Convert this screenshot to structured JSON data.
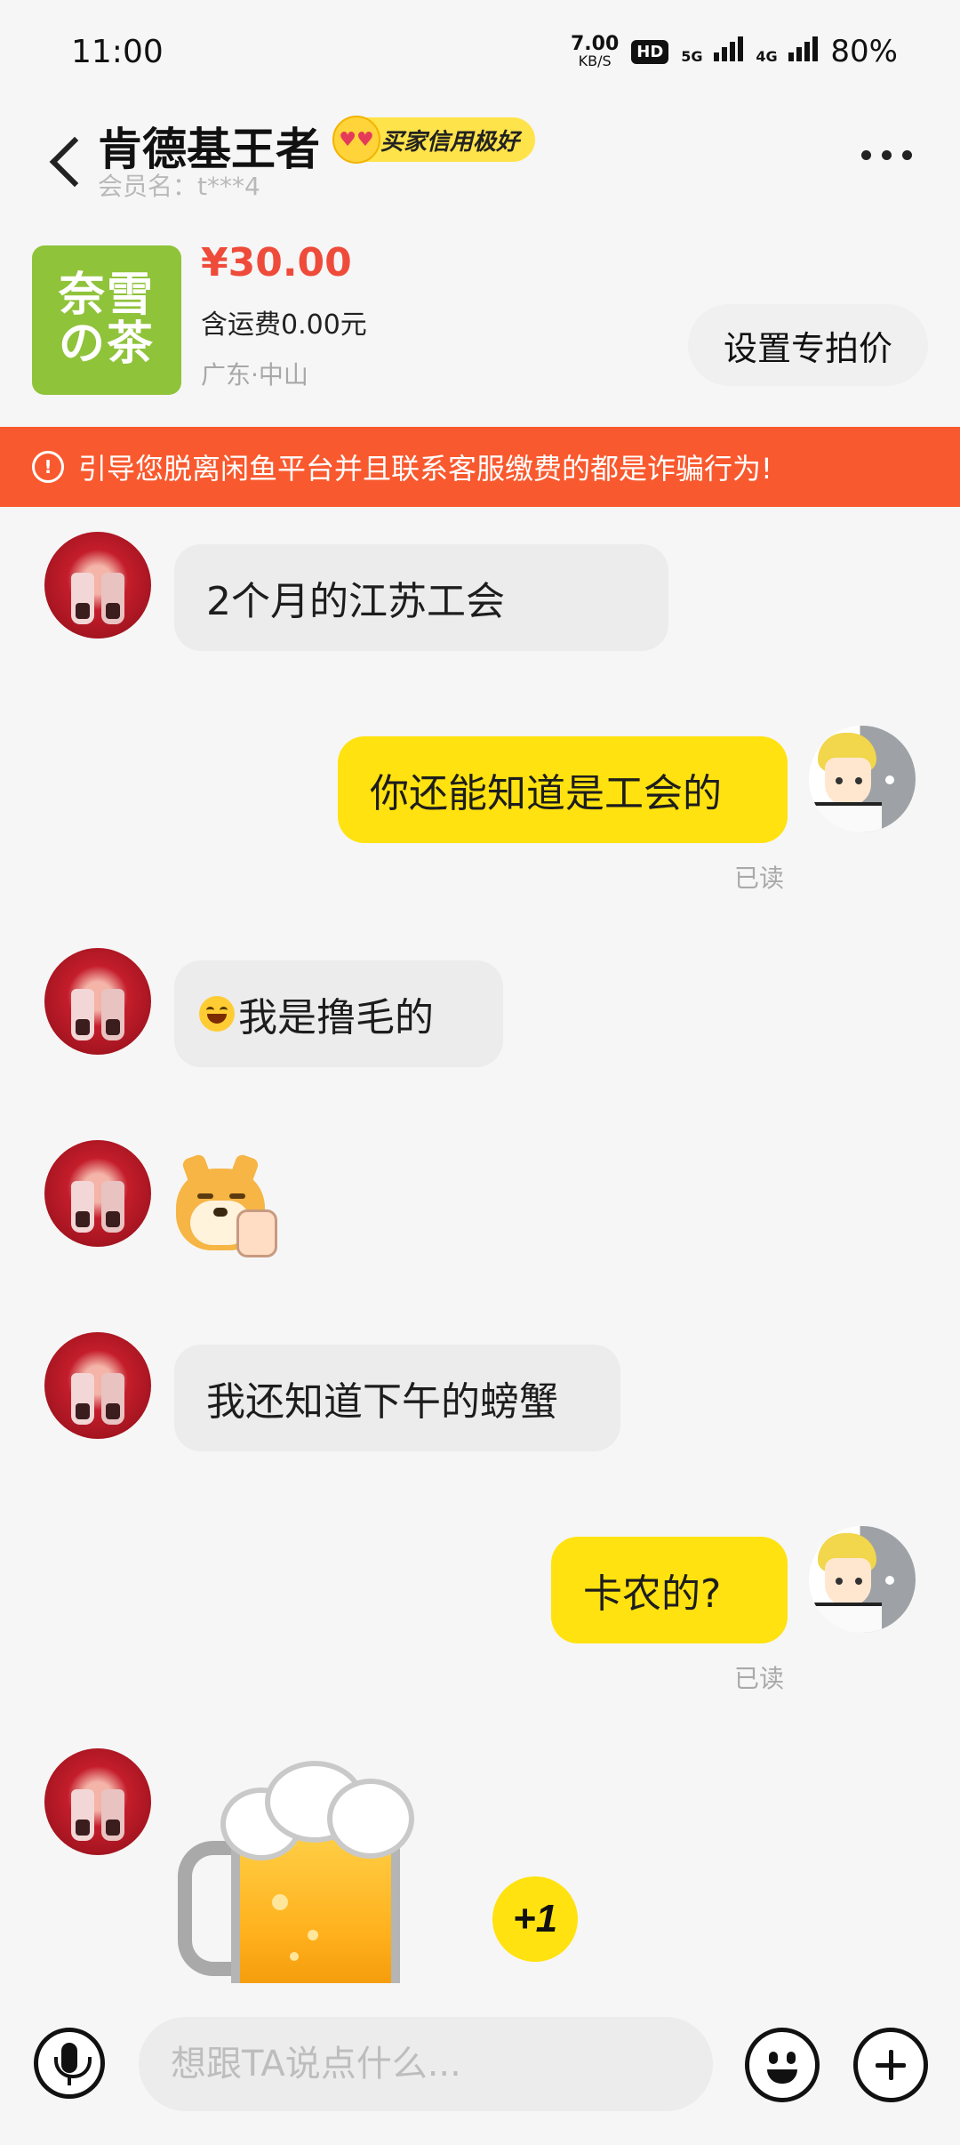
{
  "status_bar": {
    "time": "11:00",
    "net_speed_value": "7.00",
    "net_speed_unit": "KB/S",
    "hd_label": "HD",
    "signal_1": "5G",
    "signal_2": "4G",
    "battery": "80%"
  },
  "header": {
    "seller_name": "肯德基王者",
    "credit_badge": "买家信用极好",
    "member_name": "会员名：t***4"
  },
  "product": {
    "thumb_text_line1": "奈雪",
    "thumb_text_line2": "の茶",
    "price": "¥30.00",
    "shipping": "含运费0.00元",
    "location": "广东·中山",
    "special_price_button": "设置专拍价"
  },
  "warning": {
    "text": "引导您脱离闲鱼平台并且联系客服缴费的都是诈骗行为!"
  },
  "messages": [
    {
      "from": "other",
      "text": "2个月的江苏工会"
    },
    {
      "from": "self",
      "text": "你还能知道是工会的",
      "status": "已读"
    },
    {
      "from": "other",
      "text": "我是撸毛的",
      "emoji": "laughing-crying-emoji"
    },
    {
      "from": "other",
      "sticker": "doge-thumbs-up-sticker"
    },
    {
      "from": "other",
      "text": "我还知道下午的螃蟹"
    },
    {
      "from": "self",
      "text": "卡农的?",
      "status": "已读"
    },
    {
      "from": "other",
      "sticker": "beer-mug-sticker"
    }
  ],
  "plus_one": "+1",
  "input_bar": {
    "placeholder": "想跟TA说点什么...",
    "value": ""
  },
  "icons": {
    "back": "chevron-left-icon",
    "more": "more-dots-icon",
    "warning": "alert-circle-icon",
    "voice": "microphone-icon",
    "emoji": "smiley-icon",
    "add": "plus-icon"
  },
  "colors": {
    "warning_bg": "#f9592e",
    "self_bubble": "#ffe20f",
    "other_bubble": "#ececec",
    "price": "#ef4b3a",
    "credit_badge": "#ffe34a"
  }
}
